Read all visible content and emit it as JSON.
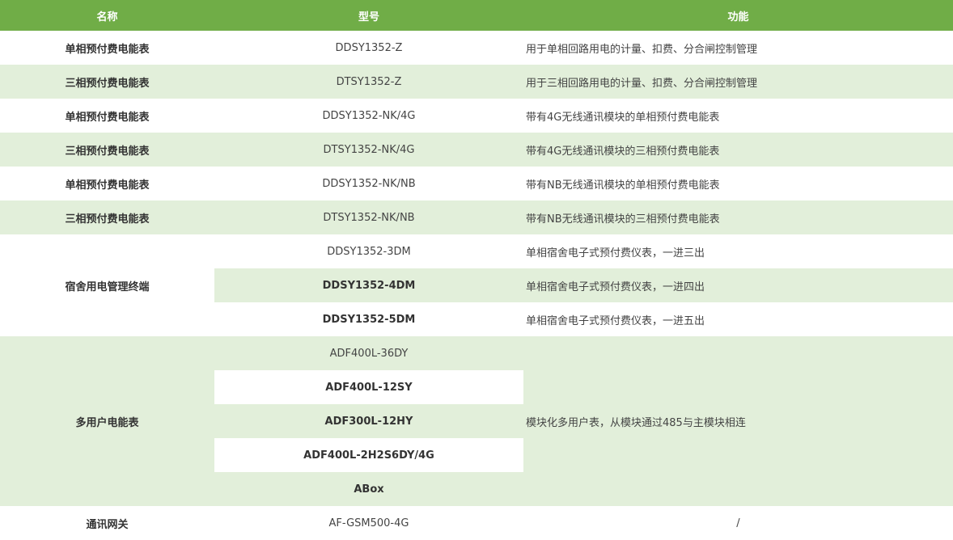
{
  "header": {
    "col_name": "名称",
    "col_model": "型号",
    "col_function": "功能"
  },
  "rows": [
    {
      "name": "单相预付费电能表",
      "model": "DDSY1352-Z",
      "function": "用于单相回路用电的计量、扣费、分合闸控制管理"
    },
    {
      "name": "三相预付费电能表",
      "model": "DTSY1352-Z",
      "function": "用于三相回路用电的计量、扣费、分合闸控制管理"
    },
    {
      "name": "单相预付费电能表",
      "model": "DDSY1352-NK/4G",
      "function": "带有4G无线通讯模块的单相预付费电能表"
    },
    {
      "name": "三相预付费电能表",
      "model": "DTSY1352-NK/4G",
      "function": "带有4G无线通讯模块的三相预付费电能表"
    },
    {
      "name": "单相预付费电能表",
      "model": "DDSY1352-NK/NB",
      "function": "带有NB无线通讯模块的单相预付费电能表"
    },
    {
      "name": "三相预付费电能表",
      "model": "DTSY1352-NK/NB",
      "function": "带有NB无线通讯模块的三相预付费电能表"
    }
  ],
  "dorm": {
    "name": "宿舍用电管理终端",
    "items": [
      {
        "model": "DDSY1352-3DM",
        "function": "单相宿舍电子式预付费仪表，一进三出"
      },
      {
        "model": "DDSY1352-4DM",
        "function": "单相宿舍电子式预付费仪表，一进四出"
      },
      {
        "model": "DDSY1352-5DM",
        "function": "单相宿舍电子式预付费仪表，一进五出"
      }
    ]
  },
  "multi_user": {
    "name": "多用户电能表",
    "function": "模块化多用户表，从模块通过485与主模块相连",
    "models": [
      "ADF400L-36DY",
      "ADF400L-12SY",
      "ADF300L-12HY",
      "ADF400L-2H2S6DY/4G",
      "ABox"
    ]
  },
  "gateway": {
    "name": "通讯网关",
    "model": "AF-GSM500-4G",
    "function": "/"
  },
  "colors": {
    "header_bg": "#70ad47",
    "stripe": "#e2efda",
    "white": "#ffffff"
  }
}
